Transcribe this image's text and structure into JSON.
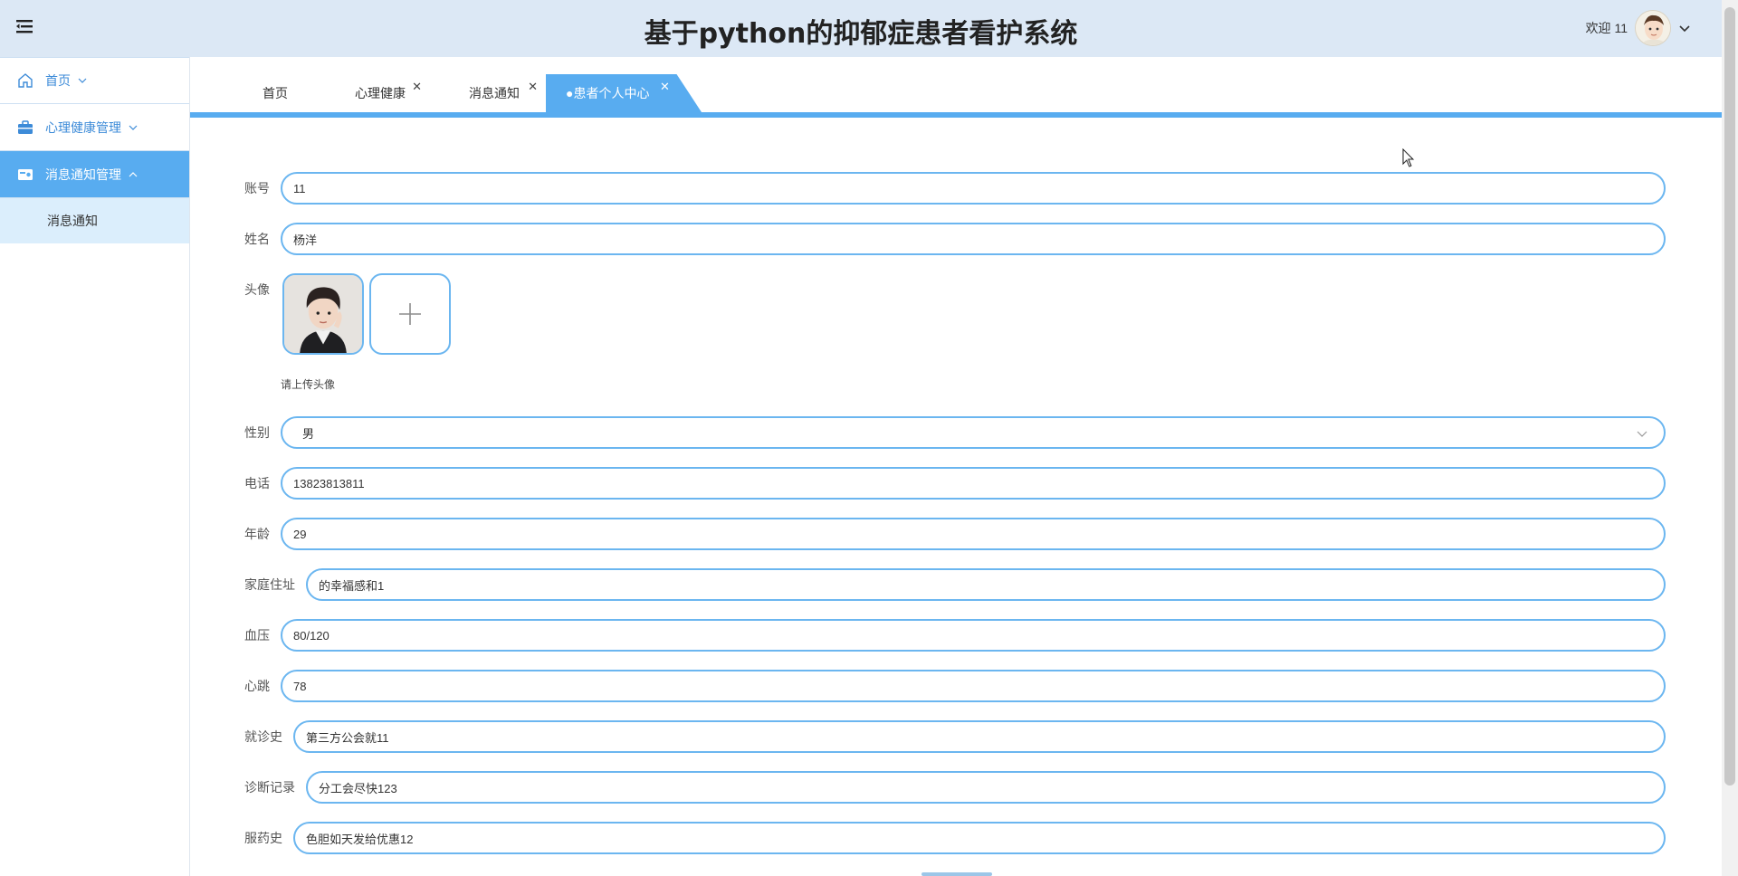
{
  "header": {
    "title": "基于python的抑郁症患者看护系统",
    "welcome": "欢迎 11"
  },
  "sidebar": {
    "items": [
      {
        "label": "首页",
        "icon": "home-icon"
      },
      {
        "label": "心理健康管理",
        "icon": "briefcase-icon"
      },
      {
        "label": "消息通知管理",
        "icon": "card-icon"
      }
    ],
    "subitems": [
      {
        "label": "消息通知"
      }
    ]
  },
  "tabs": [
    {
      "label": "首页",
      "closable": false
    },
    {
      "label": "心理健康",
      "closable": true
    },
    {
      "label": "消息通知",
      "closable": true
    },
    {
      "label": "●患者个人中心",
      "closable": true,
      "active": true
    }
  ],
  "form": {
    "account": {
      "label": "账号",
      "value": "11"
    },
    "name": {
      "label": "姓名",
      "value": "杨洋"
    },
    "avatar": {
      "label": "头像",
      "hint": "请上传头像"
    },
    "gender": {
      "label": "性别",
      "value": "男"
    },
    "phone": {
      "label": "电话",
      "value": "13823813811"
    },
    "age": {
      "label": "年龄",
      "value": "29"
    },
    "address": {
      "label": "家庭住址",
      "value": "的幸福感和1"
    },
    "blood_pressure": {
      "label": "血压",
      "value": "80/120"
    },
    "heart_rate": {
      "label": "心跳",
      "value": "78"
    },
    "visit_history": {
      "label": "就诊史",
      "value": "第三方公会就11"
    },
    "diagnosis": {
      "label": "诊断记录",
      "value": "分工会尽快123"
    },
    "medication": {
      "label": "服药史",
      "value": "色胆如天发给优惠12"
    }
  },
  "colors": {
    "accent": "#58acf0",
    "header_bg": "#dce8f5",
    "field_border": "#6bb6f0"
  }
}
